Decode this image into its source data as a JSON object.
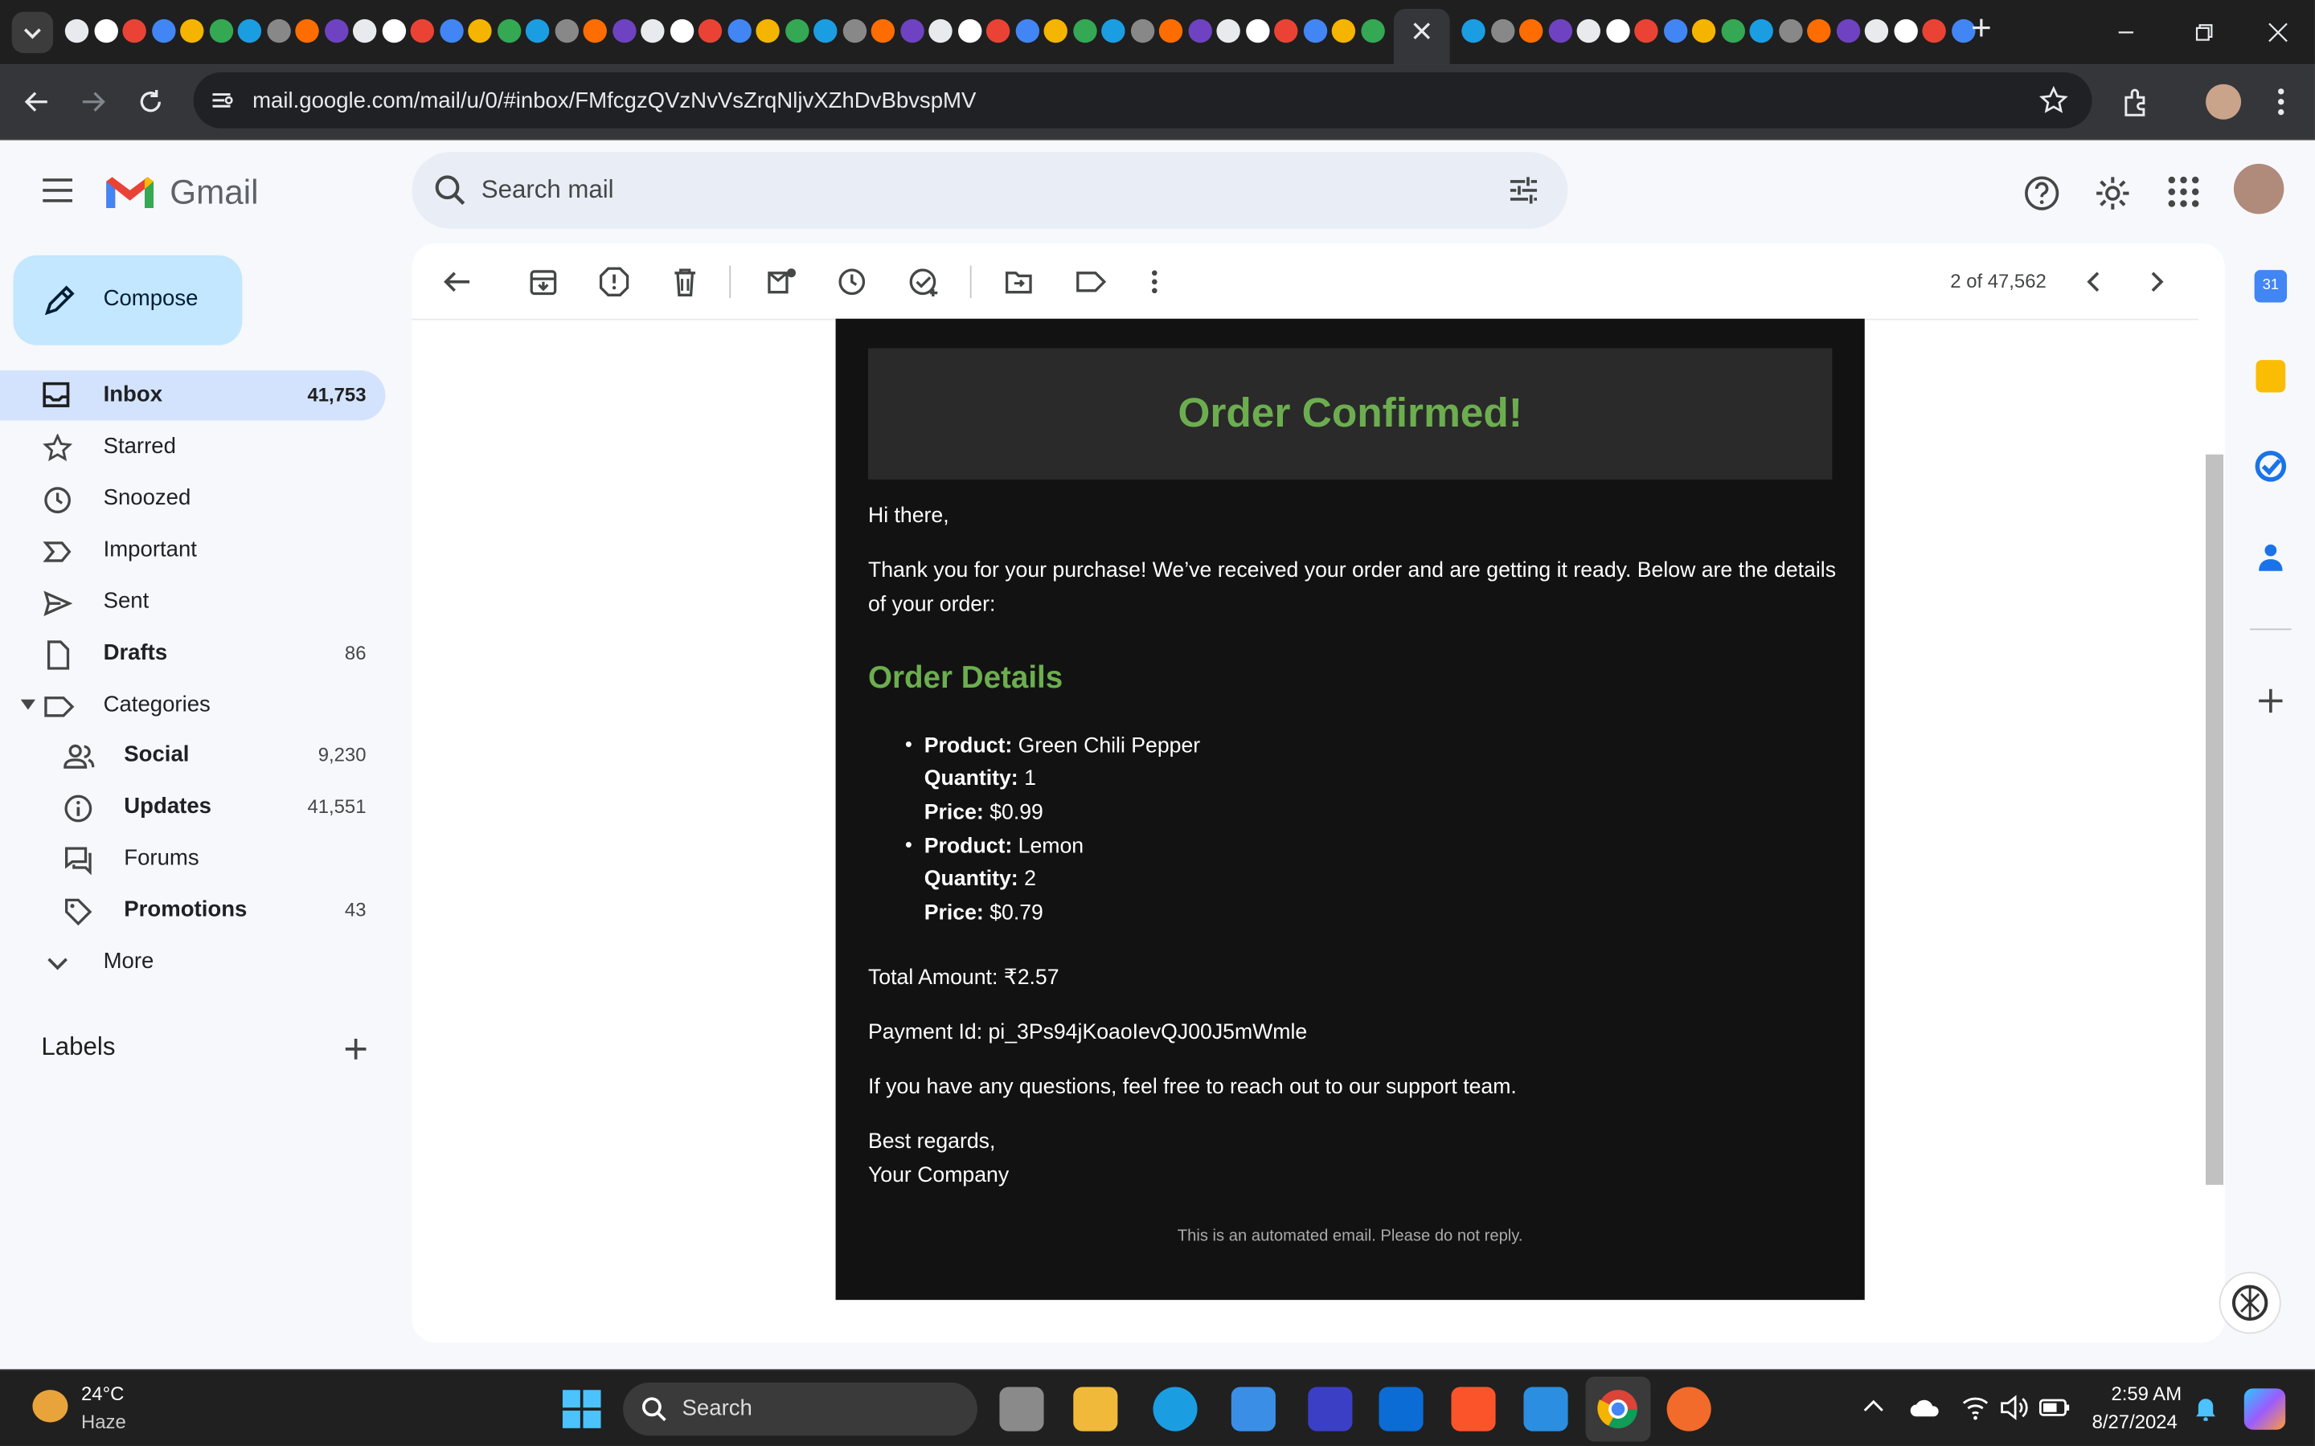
{
  "browser": {
    "url": "mail.google.com/mail/u/0/#inbox/FMfcgzQVzNvVsZrqNljvXZhDvBbvspMV",
    "new_tab": "+"
  },
  "gmail": {
    "logo_text": "Gmail",
    "search_placeholder": "Search mail",
    "compose_label": "Compose",
    "nav": [
      {
        "label": "Inbox",
        "count": "41,753"
      },
      {
        "label": "Starred",
        "count": ""
      },
      {
        "label": "Snoozed",
        "count": ""
      },
      {
        "label": "Important",
        "count": ""
      },
      {
        "label": "Sent",
        "count": ""
      },
      {
        "label": "Drafts",
        "count": "86"
      },
      {
        "label": "Categories",
        "count": ""
      }
    ],
    "categories": [
      {
        "label": "Social",
        "count": "9,230"
      },
      {
        "label": "Updates",
        "count": "41,551"
      },
      {
        "label": "Forums",
        "count": ""
      },
      {
        "label": "Promotions",
        "count": "43"
      }
    ],
    "more_label": "More",
    "labels_heading": "Labels",
    "pager": "2 of 47,562"
  },
  "email": {
    "header": "Order Confirmed!",
    "greeting": "Hi there,",
    "intro_line1": "Thank you for your purchase! We’ve received your order and are getting it ready. Below are the details",
    "intro_line2": "of your order:",
    "details_title": "Order Details",
    "product_label": "Product:",
    "quantity_label": "Quantity:",
    "price_label": "Price:",
    "items": [
      {
        "product": "Green Chili Pepper",
        "quantity": "1",
        "price": "$0.99"
      },
      {
        "product": "Lemon",
        "quantity": "2",
        "price": "$0.79"
      }
    ],
    "total": "Total Amount: ₹2.57",
    "payment": "Payment Id: pi_3Ps94jKoaoIevQJ00J5mWmle",
    "questions": "If you have any questions, feel free to reach out to our support team.",
    "regards": "Best regards,",
    "company": "Your Company",
    "footer": "This is an automated email. Please do not reply."
  },
  "taskbar": {
    "temp": "24°C",
    "weather": "Haze",
    "search_label": "Search",
    "time": "2:59 AM",
    "date": "8/27/2024"
  },
  "colors": {
    "accent_green": "#6cae4f",
    "compose_bg": "#c2e7ff",
    "inbox_selected": "#d3e3fd"
  }
}
